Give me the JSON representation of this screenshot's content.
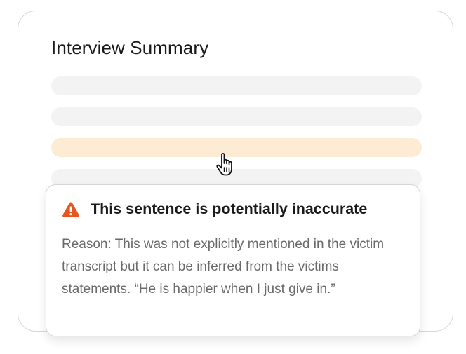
{
  "card": {
    "title": "Interview Summary"
  },
  "summary_lines": [
    {
      "state": "placeholder"
    },
    {
      "state": "placeholder"
    },
    {
      "state": "highlighted"
    },
    {
      "state": "placeholder"
    }
  ],
  "popover": {
    "icon": "warning-triangle-icon",
    "title": "This sentence is potentially inaccurate",
    "body": "Reason: This was not explicitly mentioned in the victim transcript but it can be inferred from the victims statements. “He is happier when I just give in.”"
  },
  "colors": {
    "highlight": "#fdebd3",
    "placeholder": "#f3f3f3",
    "warning": "#e8541e"
  }
}
